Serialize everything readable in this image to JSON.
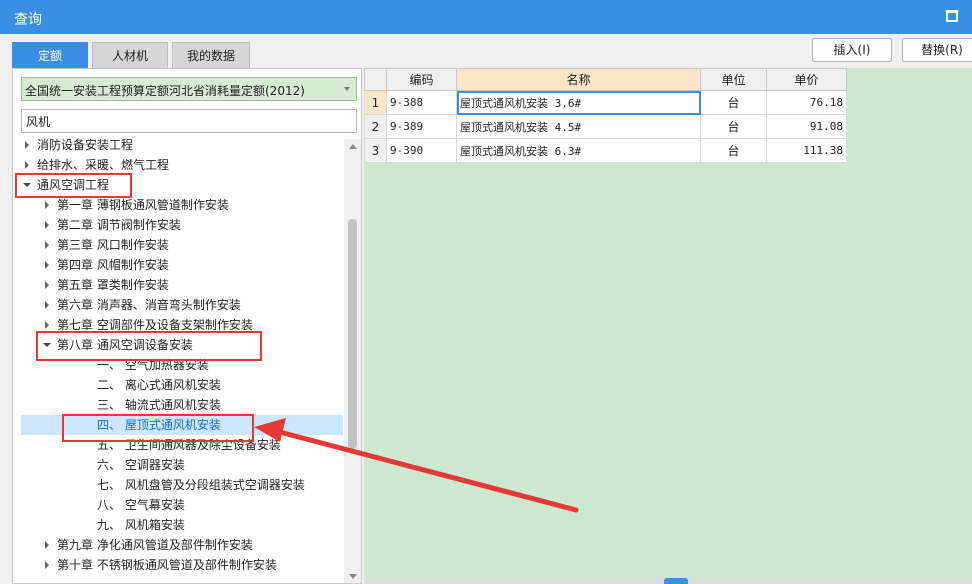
{
  "window": {
    "title": "查询"
  },
  "tabs": [
    {
      "label": "定额",
      "active": true
    },
    {
      "label": "人材机",
      "active": false
    },
    {
      "label": "我的数据",
      "active": false
    }
  ],
  "toolbar": {
    "insert_label": "插入(I)",
    "replace_label": "替换(R)"
  },
  "left": {
    "dropdown_value": "全国统一安装工程预算定额河北省消耗量定额(2012)",
    "search_value": "风机",
    "tree": [
      {
        "label": "消防设备安装工程",
        "level": 0,
        "state": "collapsed"
      },
      {
        "label": "给排水、采暖、燃气工程",
        "level": 0,
        "state": "collapsed"
      },
      {
        "label": "通风空调工程",
        "level": 0,
        "state": "expanded"
      },
      {
        "label": "第一章 薄钢板通风管道制作安装",
        "level": 1,
        "state": "collapsed"
      },
      {
        "label": "第二章 调节阀制作安装",
        "level": 1,
        "state": "collapsed"
      },
      {
        "label": "第三章 风口制作安装",
        "level": 1,
        "state": "collapsed"
      },
      {
        "label": "第四章 风帽制作安装",
        "level": 1,
        "state": "collapsed"
      },
      {
        "label": "第五章 罩类制作安装",
        "level": 1,
        "state": "collapsed"
      },
      {
        "label": "第六章 消声器、消音弯头制作安装",
        "level": 1,
        "state": "collapsed"
      },
      {
        "label": "第七章 空调部件及设备支架制作安装",
        "level": 1,
        "state": "collapsed"
      },
      {
        "label": "第八章 通风空调设备安装",
        "level": 1,
        "state": "expanded"
      },
      {
        "label": "一、 空气加热器安装",
        "level": 2,
        "state": "leaf"
      },
      {
        "label": "二、 离心式通风机安装",
        "level": 2,
        "state": "leaf"
      },
      {
        "label": "三、 轴流式通风机安装",
        "level": 2,
        "state": "leaf"
      },
      {
        "label": "四、 屋顶式通风机安装",
        "level": 2,
        "state": "leaf",
        "selected": true
      },
      {
        "label": "五、 卫生间通风器及除尘设备安装",
        "level": 2,
        "state": "leaf"
      },
      {
        "label": "六、 空调器安装",
        "level": 2,
        "state": "leaf"
      },
      {
        "label": "七、 风机盘管及分段组装式空调器安装",
        "level": 2,
        "state": "leaf"
      },
      {
        "label": "八、 空气幕安装",
        "level": 2,
        "state": "leaf"
      },
      {
        "label": "九、 风机箱安装",
        "level": 2,
        "state": "leaf"
      },
      {
        "label": "第九章 净化通风管道及部件制作安装",
        "level": 1,
        "state": "collapsed"
      },
      {
        "label": "第十章 不锈钢板通风管道及部件制作安装",
        "level": 1,
        "state": "collapsed"
      }
    ]
  },
  "grid": {
    "columns": [
      "编码",
      "名称",
      "单位",
      "单价"
    ],
    "rows": [
      {
        "num": "1",
        "code": "9-388",
        "name": "屋顶式通风机安装 3.6#",
        "unit": "台",
        "price": "76.18"
      },
      {
        "num": "2",
        "code": "9-389",
        "name": "屋顶式通风机安装 4.5#",
        "unit": "台",
        "price": "91.08"
      },
      {
        "num": "3",
        "code": "9-390",
        "name": "屋顶式通风机安装 6.3#",
        "unit": "台",
        "price": "111.38"
      }
    ]
  },
  "colors": {
    "accent": "#3a8ee6",
    "highlight": "#e53935",
    "grid_bg": "#cce8cf"
  }
}
